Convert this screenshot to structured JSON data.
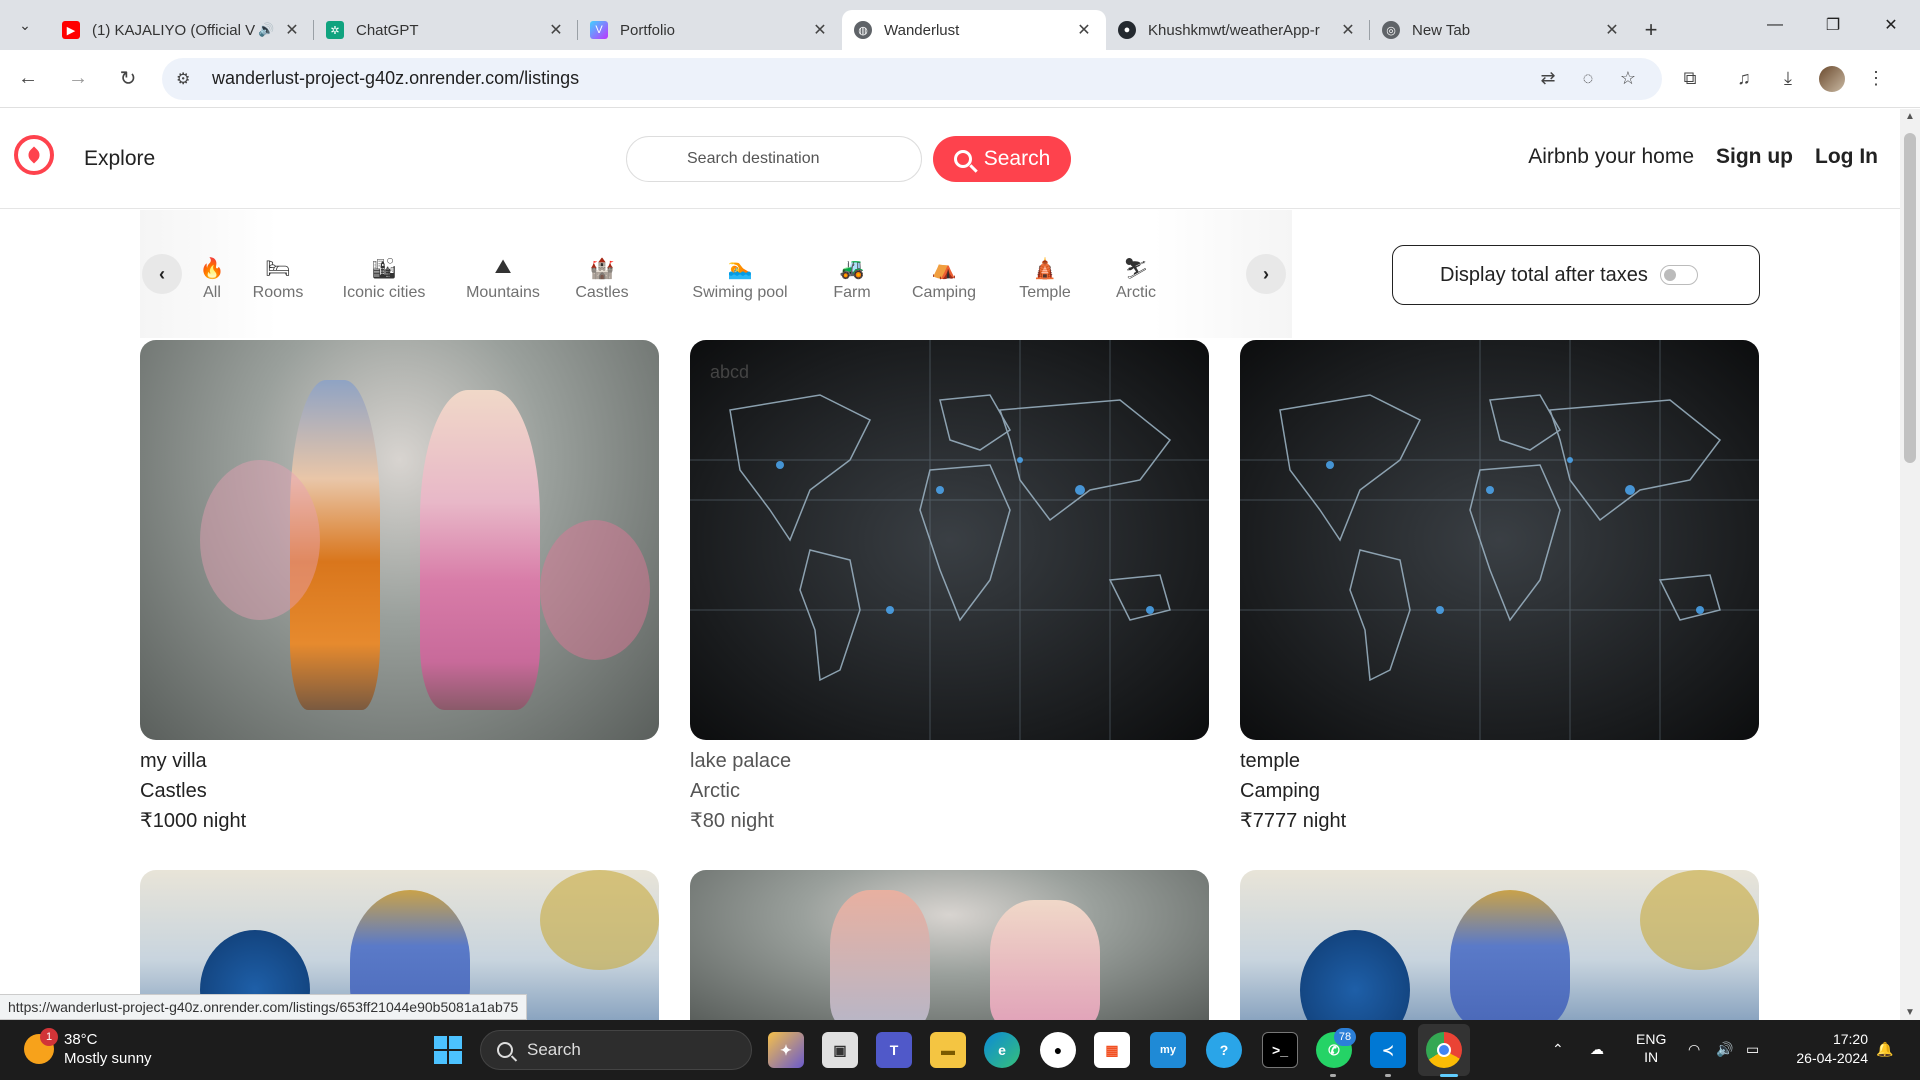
{
  "browser": {
    "tabs": [
      {
        "title": "(1) KAJALIYO (Official V",
        "icon": "youtube-icon",
        "color": "#ff0000"
      },
      {
        "title": "ChatGPT",
        "icon": "chatgpt-icon",
        "color": "#10a37f"
      },
      {
        "title": "Portfolio",
        "icon": "vite-icon",
        "color": "#8b5cf6"
      },
      {
        "title": "Wanderlust",
        "icon": "globe-icon",
        "color": "#5f6368"
      },
      {
        "title": "Khushkmwt/weatherApp-r",
        "icon": "github-icon",
        "color": "#24292f"
      },
      {
        "title": "New Tab",
        "icon": "chrome-icon",
        "color": "#5f6368"
      }
    ],
    "url": "wanderlust-project-g40z.onrender.com/listings",
    "status_url": "https://wanderlust-project-g40z.onrender.com/listings/653ff21044e90b5081a1ab75"
  },
  "navbar": {
    "explore": "Explore",
    "search_placeholder": "Search destination",
    "search_label": "Search",
    "links": [
      "Airbnb your home",
      "Sign up",
      "Log In"
    ],
    "brand_color": "#fe424d"
  },
  "filters": [
    {
      "label": "All",
      "icon": "fire-icon",
      "glyph": "🔥"
    },
    {
      "label": "Rooms",
      "icon": "bed-icon",
      "glyph": "🛏"
    },
    {
      "label": "Iconic cities",
      "icon": "city-icon",
      "glyph": "🏙"
    },
    {
      "label": "Mountains",
      "icon": "mountain-icon",
      "glyph": "⛰"
    },
    {
      "label": "Castles",
      "icon": "castle-icon",
      "glyph": "🏰"
    },
    {
      "label": "Swiming pool",
      "icon": "swimmer-icon",
      "glyph": "🏊"
    },
    {
      "label": "Farm",
      "icon": "tractor-icon",
      "glyph": "🚜"
    },
    {
      "label": "Camping",
      "icon": "tent-icon",
      "glyph": "⛺"
    },
    {
      "label": "Temple",
      "icon": "temple-icon",
      "glyph": "🛕"
    },
    {
      "label": "Arctic",
      "icon": "skier-icon",
      "glyph": "⛷"
    }
  ],
  "tax_toggle": {
    "label": "Display total after taxes",
    "enabled": false
  },
  "listings": [
    {
      "name": "my villa",
      "category": "Castles",
      "price": "₹1000 night",
      "image": "krishna-radha"
    },
    {
      "name": "lake palace",
      "category": "Arctic",
      "price": "₹80 night",
      "image": "world-map",
      "image_alt": "abcd"
    },
    {
      "name": "temple",
      "category": "Camping",
      "price": "₹7777 night",
      "image": "world-map"
    },
    {
      "image": "peacock-krishna"
    },
    {
      "image": "krishna-radha"
    },
    {
      "image": "peacock-krishna"
    }
  ],
  "taskbar": {
    "weather_temp": "38°C",
    "weather_text": "Mostly sunny",
    "weather_badge": "1",
    "search_label": "Search",
    "whatsapp_badge": "78",
    "lang_top": "ENG",
    "lang_bottom": "IN",
    "time": "17:20",
    "date": "26-04-2024"
  }
}
